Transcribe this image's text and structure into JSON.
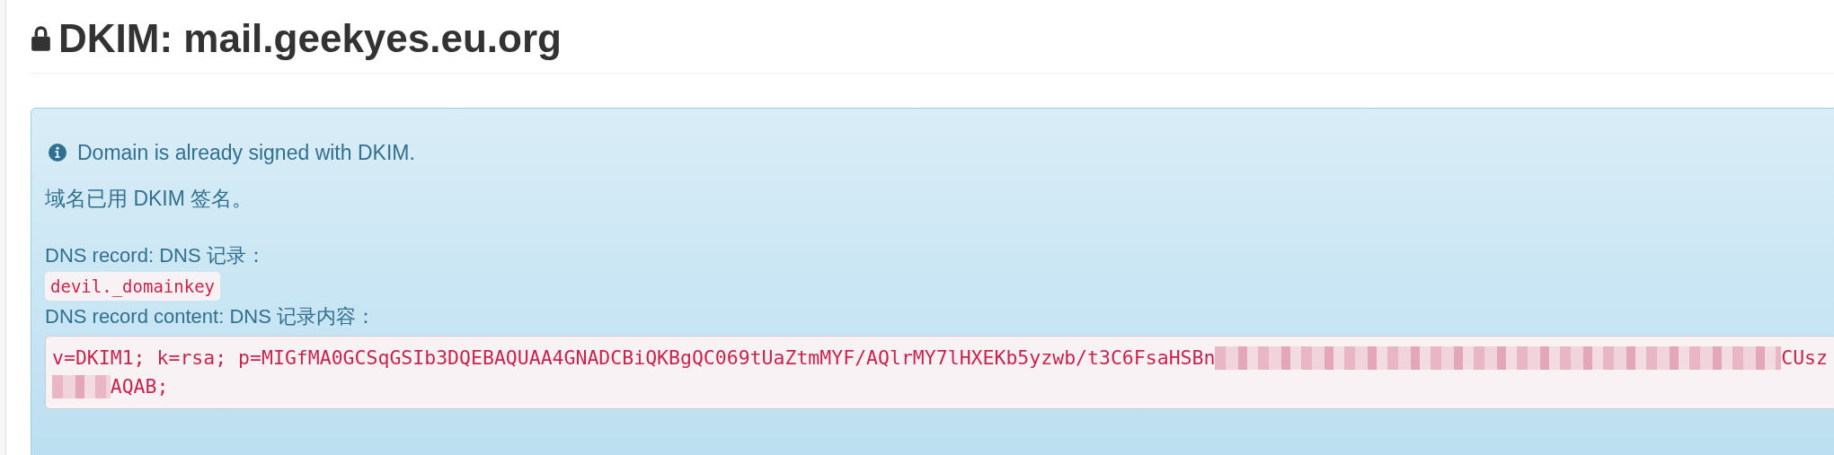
{
  "heading": "DKIM: mail.geekyes.eu.org",
  "alert": {
    "kind": "info",
    "message": "Domain is already signed with DKIM.",
    "message_zh": "域名已用 DKIM 签名。",
    "record_label": "DNS record: DNS 记录：",
    "record": "devil._domainkey",
    "content_label": "DNS record content: DNS 记录内容：",
    "content_lines": [
      {
        "segments": [
          {
            "kind": "text",
            "text": "v=DKIM1; k=rsa; p=MIGfMA0GCSqGSIb3DQEBAQUAA4GNADCBiQKBgQC069tUaZtmMYF/AQlrMY7lHXEKb5yzwb/t3C6FsaHSBn"
          },
          {
            "kind": "redacted"
          },
          {
            "kind": "text",
            "text": "CUsz"
          }
        ]
      },
      {
        "segments": [
          {
            "kind": "redacted"
          },
          {
            "kind": "text",
            "text": "AQAB;"
          }
        ]
      }
    ]
  }
}
